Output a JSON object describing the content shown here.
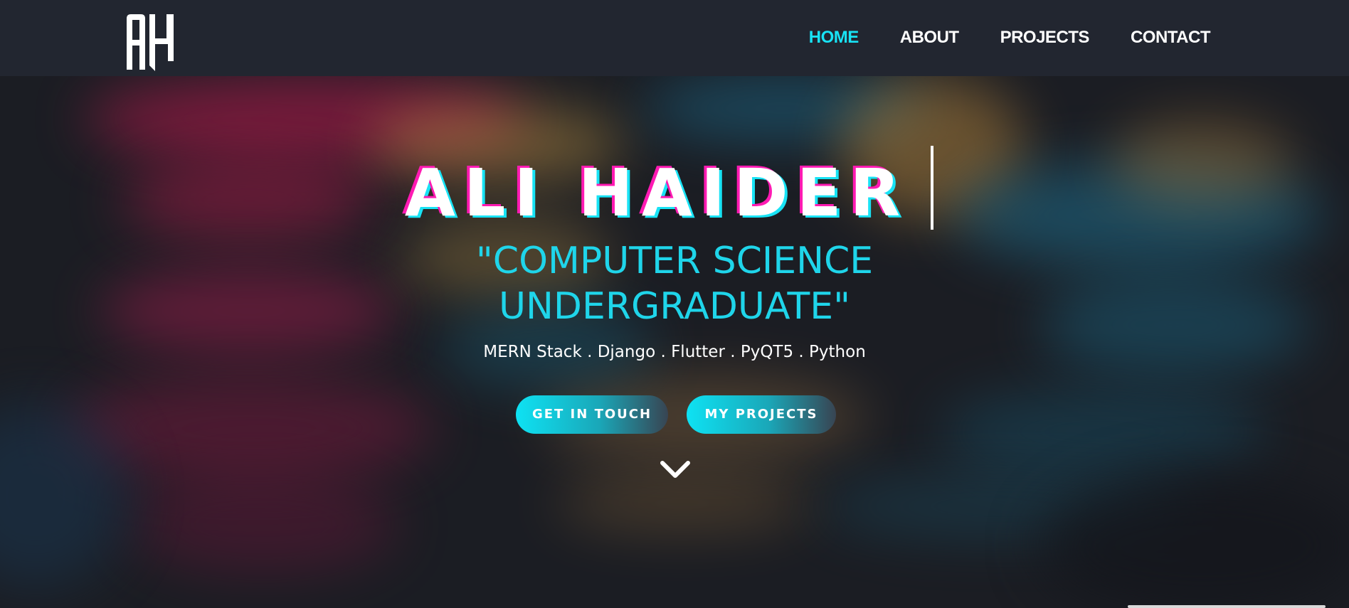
{
  "logo": {
    "text": "AH",
    "icon": "ah-monogram-logo"
  },
  "nav": {
    "items": [
      {
        "label": "HOME",
        "active": true
      },
      {
        "label": "ABOUT",
        "active": false
      },
      {
        "label": "PROJECTS",
        "active": false
      },
      {
        "label": "CONTACT",
        "active": false
      }
    ]
  },
  "hero": {
    "name": "ALI HAIDER",
    "subtitle_line1": "\"COMPUTER SCIENCE",
    "subtitle_line2": "UNDERGRADUATE\"",
    "stack": "MERN Stack . Django . Flutter . PyQT5 . Python",
    "buttons": {
      "contact": "GET IN TOUCH",
      "projects": "MY PROJECTS"
    },
    "scroll_icon": "chevron-down-icon"
  },
  "colors": {
    "accent": "#18e3f5",
    "glitch_pink": "#ff1ab3",
    "navbar_bg": "#222630",
    "page_bg": "#1b1d23"
  }
}
